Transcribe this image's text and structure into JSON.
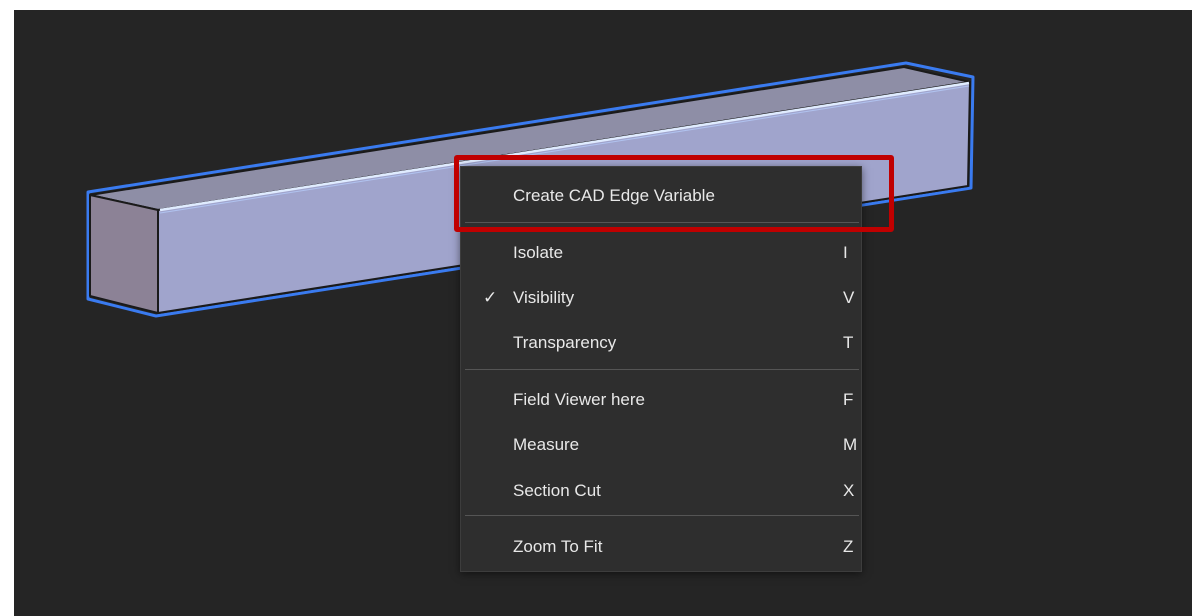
{
  "menu": {
    "items": [
      {
        "label": "Create CAD Edge Variable",
        "shortcut": "",
        "checked": false
      },
      {
        "label": "Isolate",
        "shortcut": "I",
        "checked": false
      },
      {
        "label": "Visibility",
        "shortcut": "V",
        "checked": true
      },
      {
        "label": "Transparency",
        "shortcut": "T",
        "checked": false
      },
      {
        "label": "Field Viewer here",
        "shortcut": "F",
        "checked": false
      },
      {
        "label": "Measure",
        "shortcut": "M",
        "checked": false
      },
      {
        "label": "Section Cut",
        "shortcut": "X",
        "checked": false
      },
      {
        "label": "Zoom To Fit",
        "shortcut": "Z",
        "checked": false
      }
    ],
    "check_glyph": "✓"
  },
  "colors": {
    "highlight": "#c00000",
    "selection_outline": "#3a7bf0",
    "beam_front": "#a0a4cc",
    "beam_top": "#8e8ea6",
    "beam_end": "#8c8296"
  }
}
